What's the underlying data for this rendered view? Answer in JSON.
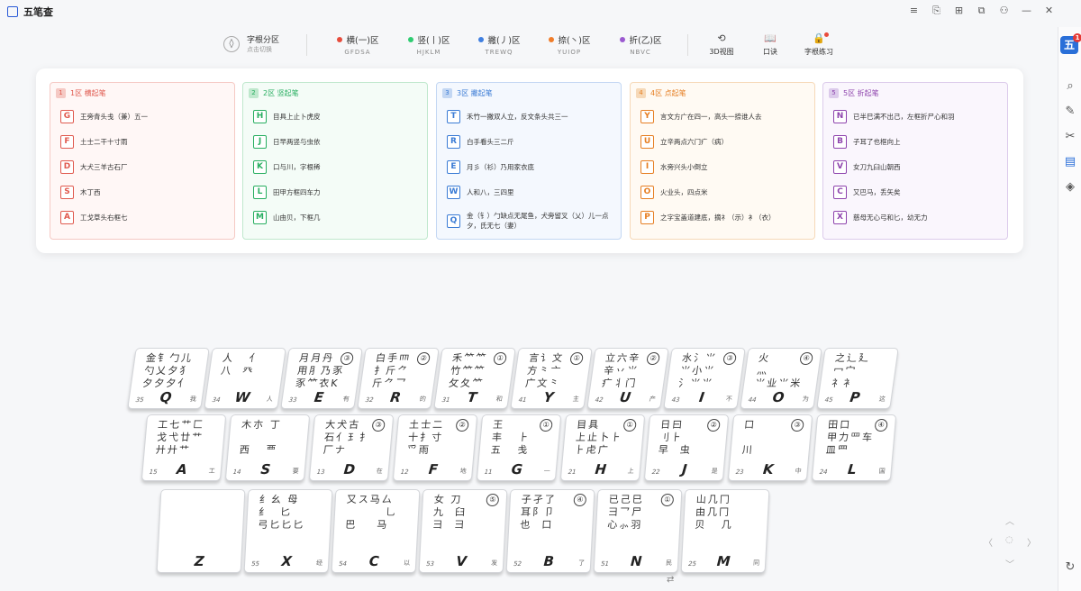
{
  "app": {
    "title": "五笔查"
  },
  "window_controls": [
    "≡",
    "⎘",
    "⊞",
    "⧉",
    "⚇",
    "—",
    "✕"
  ],
  "toolbar": {
    "root_title": "字根分区",
    "root_sub": "点击切换",
    "zones": [
      {
        "label": "横(一)区",
        "keys": "GFDSA",
        "color": "#e74c3c"
      },
      {
        "label": "竖(丨)区",
        "keys": "HJKLM",
        "color": "#2ecc71"
      },
      {
        "label": "撇(丿)区",
        "keys": "TREWQ",
        "color": "#3f7fe0"
      },
      {
        "label": "捺(丶)区",
        "keys": "YUIOP",
        "color": "#f07d2a"
      },
      {
        "label": "折(乙)区",
        "keys": "NBVC",
        "color": "#9b59d0"
      }
    ],
    "tools": [
      {
        "label": "3D视图",
        "icon": "⟲"
      },
      {
        "label": "口诀",
        "icon": "📖"
      },
      {
        "label": "字根练习",
        "icon": "🔒"
      }
    ]
  },
  "rail": {
    "badge": "五",
    "badge_count": "1"
  },
  "panel": {
    "columns": [
      {
        "num": "1",
        "title": "1区 横起笔",
        "color": "#e05a4f",
        "bg": "#fff7f6",
        "border": "#f5c9c4",
        "rows": [
          {
            "key": "G",
            "text": "王旁青头戋（兼）五一"
          },
          {
            "key": "F",
            "text": "土士二干十寸雨"
          },
          {
            "key": "D",
            "text": "大犬三羊古石厂"
          },
          {
            "key": "S",
            "text": "木丁西"
          },
          {
            "key": "A",
            "text": "工戈草头右框七"
          }
        ]
      },
      {
        "num": "2",
        "title": "2区 竖起笔",
        "color": "#27ae60",
        "bg": "#f4fcf7",
        "border": "#bfe8cd",
        "rows": [
          {
            "key": "H",
            "text": "目具上止卜虎皮"
          },
          {
            "key": "J",
            "text": "日早两竖与虫依"
          },
          {
            "key": "K",
            "text": "口与川，字根稀"
          },
          {
            "key": "L",
            "text": "田甲方框四车力"
          },
          {
            "key": "M",
            "text": "山由贝，下框几"
          }
        ]
      },
      {
        "num": "3",
        "title": "3区 撇起笔",
        "color": "#3a7bd5",
        "bg": "#f4f8fe",
        "border": "#c3d7f3",
        "rows": [
          {
            "key": "T",
            "text": "禾竹一撇双人立，反文条头共三一"
          },
          {
            "key": "R",
            "text": "白手看头三二斤"
          },
          {
            "key": "E",
            "text": "月彡（衫）乃用家衣底"
          },
          {
            "key": "W",
            "text": "人和八，三四里"
          },
          {
            "key": "Q",
            "text": "金（钅）勹缺点无尾鱼，犬旁留叉（乂）儿一点夕，氏无七（妻）"
          }
        ]
      },
      {
        "num": "4",
        "title": "4区 点起笔",
        "color": "#e67e22",
        "bg": "#fffaf3",
        "border": "#f6d9b8",
        "rows": [
          {
            "key": "Y",
            "text": "言文方广在四一，高头一捺谁人去"
          },
          {
            "key": "U",
            "text": "立辛两点六门疒（病）"
          },
          {
            "key": "I",
            "text": "水旁兴头小倒立"
          },
          {
            "key": "O",
            "text": "火业头，四点米"
          },
          {
            "key": "P",
            "text": "之字宝盖道建底，摘礻（示）衤（衣）"
          }
        ]
      },
      {
        "num": "5",
        "title": "5区 折起笔",
        "color": "#8e44ad",
        "bg": "#faf6fd",
        "border": "#dccbeb",
        "rows": [
          {
            "key": "N",
            "text": "已半巳满不出己，左框折尸心和羽"
          },
          {
            "key": "B",
            "text": "子耳了也框向上"
          },
          {
            "key": "V",
            "text": "女刀九臼山朝西"
          },
          {
            "key": "C",
            "text": "又巴马，丢矢矣"
          },
          {
            "key": "X",
            "text": "慈母无心弓和匕，幼无力"
          }
        ]
      }
    ]
  },
  "keyboard": {
    "rows": [
      [
        {
          "key": "Q",
          "num": "35",
          "word": "我",
          "roots": "金钅勹儿\n勺乂夕犭\n夕夕夕亻",
          "stroke": ""
        },
        {
          "key": "W",
          "num": "34",
          "word": "人",
          "roots": "人   亻\n八  癶\n",
          "stroke": ""
        },
        {
          "key": "E",
          "num": "33",
          "word": "有",
          "roots": "月月丹\n用⺼乃豕\n豕⺮衣K",
          "stroke": "③"
        },
        {
          "key": "R",
          "num": "32",
          "word": "的",
          "roots": "白手⺵\n扌斤⺈\n斤⺈乛",
          "stroke": "②"
        },
        {
          "key": "T",
          "num": "31",
          "word": "和",
          "roots": "禾⺮⺮\n竹⺮⺮\n攵夂⺮",
          "stroke": "①"
        },
        {
          "key": "Y",
          "num": "41",
          "word": "主",
          "roots": "言讠文\n方⺀亠\n广文⺀",
          "stroke": "①"
        },
        {
          "key": "U",
          "num": "42",
          "word": "产",
          "roots": "立六辛\n辛丷⺌\n疒丬门",
          "stroke": "②"
        },
        {
          "key": "I",
          "num": "43",
          "word": "不",
          "roots": "水氵⺌\n⺌小⺌\n氵⺌⺌",
          "stroke": "③"
        },
        {
          "key": "O",
          "num": "44",
          "word": "为",
          "roots": "火\n灬\n⺌业⺌米",
          "stroke": "④"
        },
        {
          "key": "P",
          "num": "45",
          "word": "这",
          "roots": "之辶廴\n冖宀\n礻衤",
          "stroke": ""
        }
      ],
      [
        {
          "key": "A",
          "num": "15",
          "word": "工",
          "roots": "工七⺾匚\n戈弋廿⺾\n廾廾⺾",
          "stroke": ""
        },
        {
          "key": "S",
          "num": "14",
          "word": "要",
          "roots": "木朩 丁\n\n西   覀",
          "stroke": ""
        },
        {
          "key": "D",
          "num": "13",
          "word": "在",
          "roots": "大犬古\n石⺅⺩⺘\n厂ナ",
          "stroke": "③"
        },
        {
          "key": "F",
          "num": "12",
          "word": "地",
          "roots": "土士二\n十扌寸\n⺤雨",
          "stroke": "②"
        },
        {
          "key": "G",
          "num": "11",
          "word": "一",
          "roots": "王\n丰   ⺊\n五   戋",
          "stroke": "①"
        },
        {
          "key": "H",
          "num": "21",
          "word": "上",
          "roots": "目具\n上止卜⺊\n⺊虍广",
          "stroke": "①"
        },
        {
          "key": "J",
          "num": "22",
          "word": "是",
          "roots": "日曰\n刂⺊\n早  虫",
          "stroke": "②"
        },
        {
          "key": "K",
          "num": "23",
          "word": "中",
          "roots": "口\n\n川",
          "stroke": "③"
        },
        {
          "key": "L",
          "num": "24",
          "word": "国",
          "roots": "田口\n甲力罒车\n皿⺲",
          "stroke": "④"
        }
      ],
      [
        {
          "key": "Z",
          "num": "",
          "word": "",
          "roots": "",
          "stroke": ""
        },
        {
          "key": "X",
          "num": "55",
          "word": "经",
          "roots": "纟幺 母\n纟  匕\n弓匕匕匕",
          "stroke": ""
        },
        {
          "key": "C",
          "num": "54",
          "word": "以",
          "roots": "又ス马厶\n        ⺃\n巴    马",
          "stroke": ""
        },
        {
          "key": "V",
          "num": "53",
          "word": "发",
          "roots": "女 刀\n九  臼\n彐  彐",
          "stroke": "⑤"
        },
        {
          "key": "B",
          "num": "52",
          "word": "了",
          "roots": "子孑了\n耳阝卩\n也  口",
          "stroke": "④"
        },
        {
          "key": "N",
          "num": "51",
          "word": "民",
          "roots": "已己巳\n⺕乛尸\n心⺗羽",
          "stroke": "①"
        },
        {
          "key": "M",
          "num": "25",
          "word": "同",
          "roots": "山几冂\n由几冂\n贝   几",
          "stroke": ""
        }
      ]
    ]
  }
}
